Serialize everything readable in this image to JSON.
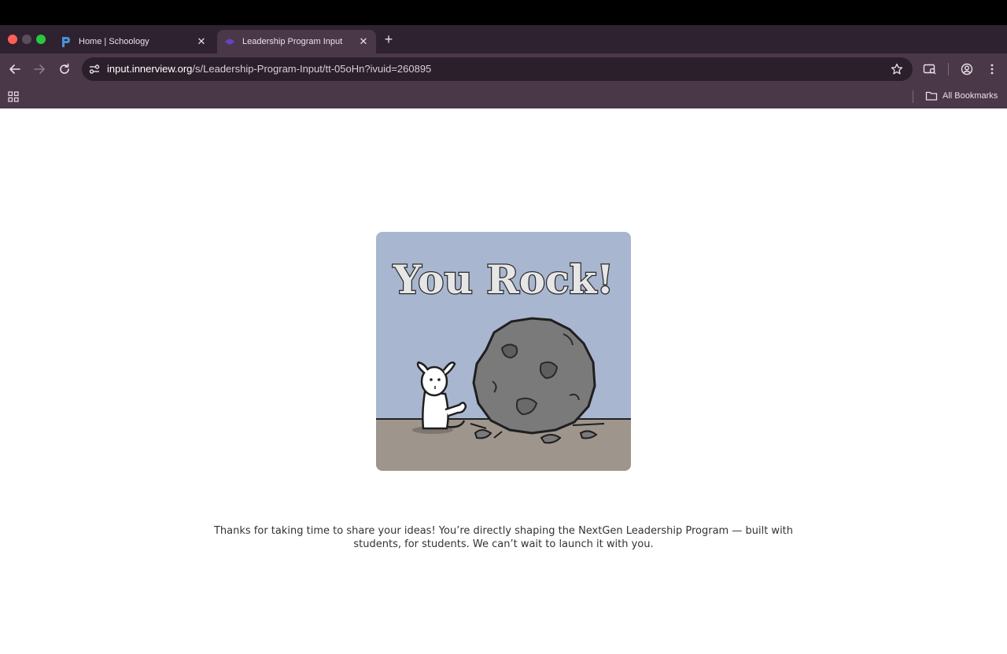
{
  "browser": {
    "tabs": [
      {
        "title": "Home | Schoology",
        "active": false,
        "favicon": "schoology-icon"
      },
      {
        "title": "Leadership Program Input",
        "active": true,
        "favicon": "innerview-icon"
      }
    ],
    "new_tab_label": "+",
    "close_glyph": "✕",
    "url_host": "input.innerview.org",
    "url_path": "/s/Leadership-Program-Input/tt-05oHn?ivuid=260895",
    "bookmarks_label": "All Bookmarks"
  },
  "page": {
    "image_text": "You Rock!",
    "message": "Thanks for taking  time to share your ideas! You’re directly shaping the NextGen Leadership Program — built with students, for students. We can’t wait to launch it with you."
  },
  "colors": {
    "tab_strip": "#2f2230",
    "toolbar": "#4a3848",
    "image_sky": "#a9b6cf",
    "image_ground": "#9e958c"
  }
}
